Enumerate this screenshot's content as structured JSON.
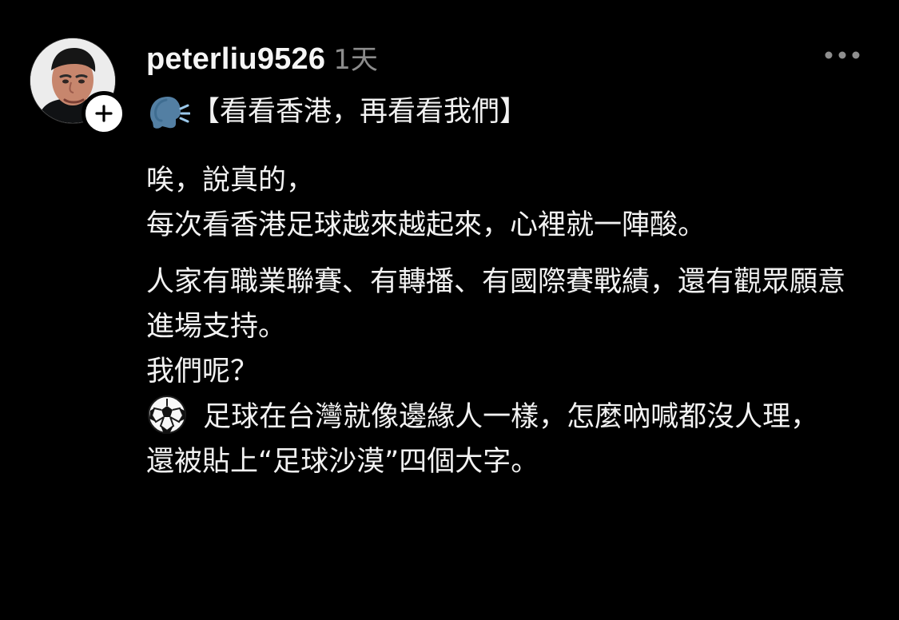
{
  "post": {
    "author": {
      "username": "peterliu9526",
      "time_ago": "1天"
    },
    "actions": {
      "follow_icon": "plus-icon",
      "more_icon": "more-horizontal-icon"
    },
    "content": {
      "title": "【看看香港，再看看我們】",
      "title_icon": "speaking-head-icon",
      "lines": [
        "唉，說真的，",
        "每次看香港足球越來越起來，心裡就一陣酸。",
        "人家有職業聯賽、有轉播、有國際賽戰績，還有觀眾願意進場支持。",
        "我們呢？",
        "足球在台灣就像邊緣人一樣，怎麼吶喊都沒人理，",
        "還被貼上“足球沙漠”四個大字。"
      ],
      "inline_icons": {
        "line_5": "soccer-ball-icon"
      }
    }
  },
  "colors": {
    "background": "#000000",
    "primary_text": "#f3f3f3",
    "secondary_text": "#8c8c8c",
    "badge_background": "#ffffff"
  }
}
